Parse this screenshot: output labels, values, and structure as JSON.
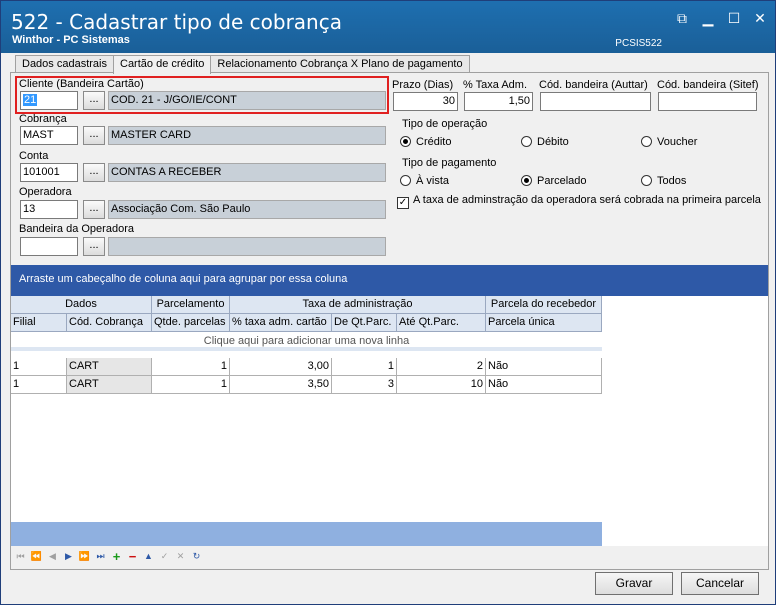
{
  "window": {
    "title": "522 - Cadastrar tipo de cobrança",
    "subtitle": "Winthor - PC Sistemas",
    "code": "PCSIS522",
    "controls": [
      "restore-icon",
      "minimize-icon",
      "maximize-icon",
      "close-icon"
    ]
  },
  "tabs": [
    {
      "label": "Dados cadastrais",
      "active": false
    },
    {
      "label": "Cartão de crédito",
      "active": true
    },
    {
      "label": "Relacionamento Cobrança X Plano de pagamento",
      "active": false
    }
  ],
  "form": {
    "cliente": {
      "label": "Cliente (Bandeira Cartão)",
      "code": "21",
      "desc": "COD. 21 - J/GO/IE/CONT"
    },
    "cobranca": {
      "label": "Cobrança",
      "code": "MAST",
      "desc": "MASTER CARD"
    },
    "conta": {
      "label": "Conta",
      "code": "101001",
      "desc": "CONTAS A RECEBER"
    },
    "operadora": {
      "label": "Operadora",
      "code": "13",
      "desc": "Associação Com. São Paulo"
    },
    "bandeira_operadora": {
      "label": "Bandeira da Operadora",
      "code": "",
      "desc": ""
    },
    "dots_label": "...",
    "prazo": {
      "label": "Prazo (Dias)",
      "value": "30"
    },
    "taxa": {
      "label": "% Taxa Adm.",
      "value": "1,50"
    },
    "cod_auttar": {
      "label": "Cód. bandeira (Auttar)",
      "value": ""
    },
    "cod_sitef": {
      "label": "Cód. bandeira (Sitef)",
      "value": ""
    },
    "tipo_operacao": {
      "label": "Tipo de operação",
      "options": [
        "Crédito",
        "Débito",
        "Voucher"
      ],
      "selected": "Crédito"
    },
    "tipo_pagamento": {
      "label": "Tipo de pagamento",
      "options": [
        "À vista",
        "Parcelado",
        "Todos"
      ],
      "selected": "Parcelado"
    },
    "checkbox": {
      "label": "A taxa de adminstração da operadora será cobrada na primeira parcela",
      "checked": true
    }
  },
  "grid": {
    "group_hint": "Arraste um cabeçalho de coluna aqui para agrupar por essa coluna",
    "bands": [
      "Dados",
      "Parcelamento",
      "Taxa de administração",
      "Parcela do recebedor"
    ],
    "columns": [
      "Filial",
      "Cód. Cobrança",
      "Qtde. parcelas",
      "% taxa adm. cartão",
      "De Qt.Parc.",
      "Até Qt.Parc.",
      "Parcela única"
    ],
    "new_row_hint": "Clique aqui para adicionar uma nova linha",
    "rows": [
      [
        "1",
        "CART",
        "1",
        "3,00",
        "1",
        "2",
        "Não"
      ],
      [
        "1",
        "CART",
        "1",
        "3,50",
        "3",
        "10",
        "Não"
      ]
    ]
  },
  "navigator": [
    "first-icon",
    "prev-page-icon",
    "prev-icon",
    "next-icon",
    "next-page-icon",
    "last-icon",
    "add-icon",
    "delete-icon",
    "edit-icon",
    "post-icon",
    "cancel-icon",
    "refresh-icon"
  ],
  "buttons": {
    "save": "Gravar",
    "cancel": "Cancelar"
  }
}
